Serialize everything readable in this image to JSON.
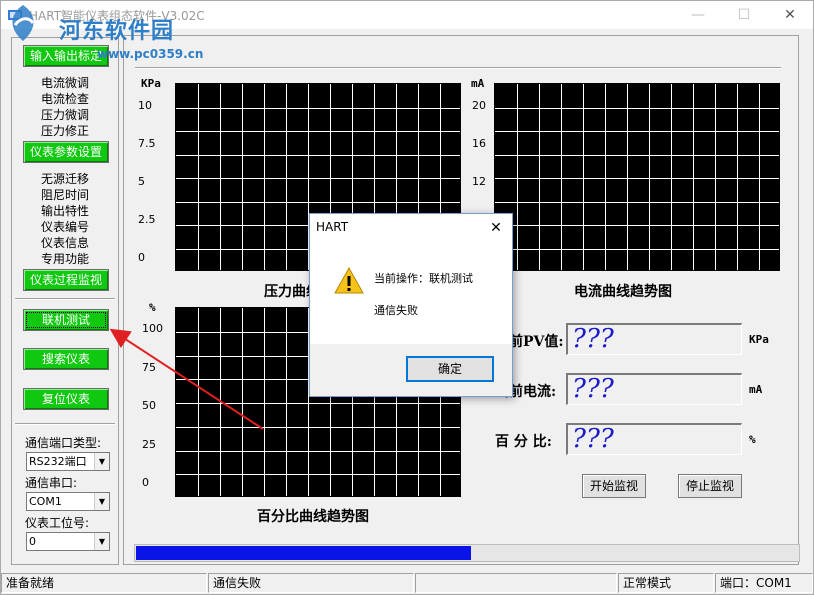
{
  "window": {
    "title": "HART智能仪表组态软件-V3.02C",
    "minimize": "—",
    "maximize": "☐",
    "close": "✕"
  },
  "watermark": {
    "name": "河东软件园",
    "url": "www.pc0359.cn"
  },
  "sidebar": {
    "btn_output_calibration": "输入输出标定",
    "group1": [
      "电流微调",
      "电流检查",
      "压力微调",
      "压力修正"
    ],
    "btn_param_setting": "仪表参数设置",
    "group2": [
      "无源迁移",
      "阻尼时间",
      "输出特性",
      "仪表编号",
      "仪表信息",
      "专用功能"
    ],
    "btn_process_monitor": "仪表过程监视",
    "btn_online_test": "联机测试",
    "btn_search": "搜索仪表",
    "btn_reset": "复位仪表",
    "port_type_label": "通信端口类型:",
    "port_type_value": "RS232端口",
    "serial_label": "通信串口:",
    "serial_value": "COM1",
    "station_label": "仪表工位号:",
    "station_value": "0"
  },
  "charts": {
    "pressure": {
      "unit": "KPa",
      "ticks": [
        "10",
        "7.5",
        "5",
        "2.5",
        "0"
      ],
      "title": "压力曲线趋势图"
    },
    "current": {
      "unit": "mA",
      "ticks": [
        "20",
        "16",
        "12"
      ],
      "title": "电流曲线趋势图"
    },
    "percent": {
      "unit": "%",
      "ticks": [
        "100",
        "75",
        "50",
        "25",
        "0"
      ],
      "title": "百分比曲线趋势图"
    }
  },
  "readouts": {
    "pv_label": "当前PV值:",
    "pv_value": "???",
    "pv_unit": "KPa",
    "current_label": "当前电流:",
    "current_value": "???",
    "current_unit": "mA",
    "percent_label": "百 分 比:",
    "percent_value": "???",
    "percent_unit": "%"
  },
  "buttons": {
    "start_monitor": "开始监视",
    "stop_monitor": "停止监视"
  },
  "progress": {
    "fraction": 0.505
  },
  "statusbar": {
    "ready": "准备就绪",
    "comm": "通信失败",
    "blank": "",
    "mode": "正常模式",
    "port": "端口：COM1"
  },
  "dialog": {
    "title": "HART",
    "close": "✕",
    "line1": "当前操作：联机测试",
    "line2": "通信失败",
    "ok": "确定"
  },
  "colors": {
    "button_green": "#11c811",
    "chart_bg": "#000000",
    "grid": "#ffffff",
    "readout_text": "#1a1ac8",
    "progress": "#0a14e8",
    "annotation_arrow": "#e02020"
  }
}
